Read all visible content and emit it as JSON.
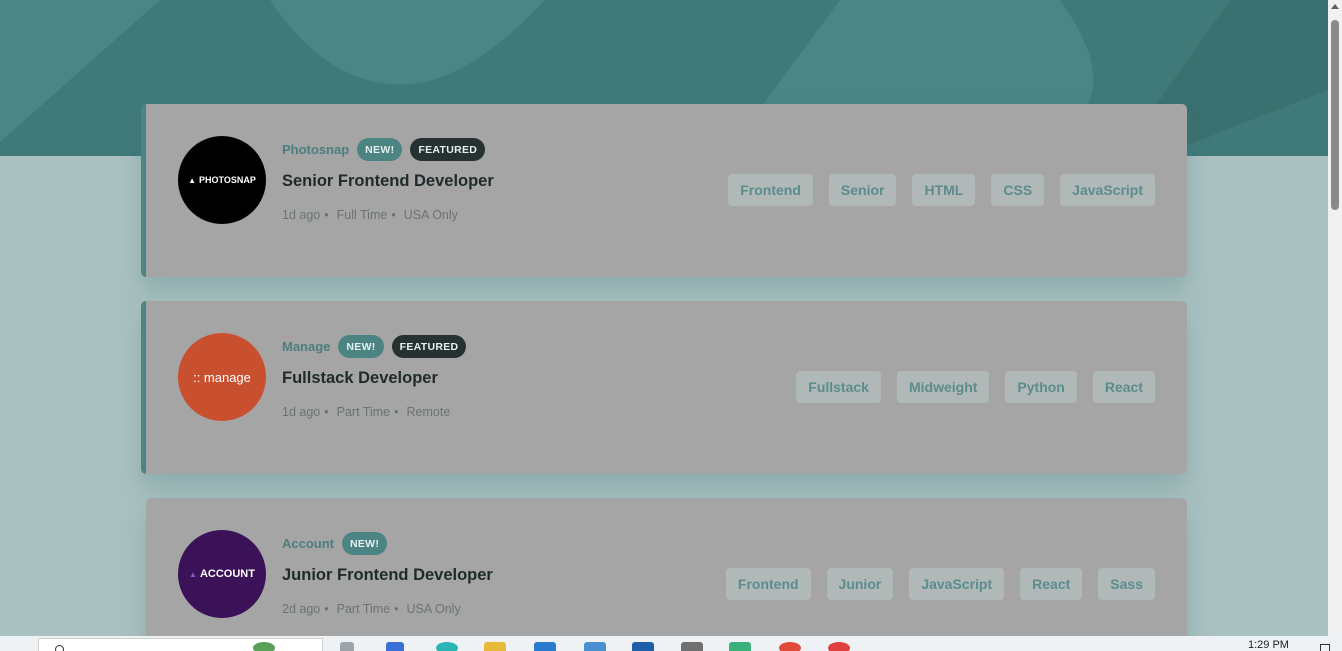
{
  "jobs": [
    {
      "company": "Photosnap",
      "logo_text": "PHOTOSNAP",
      "logo_color": "#000000",
      "new_label": "NEW!",
      "featured_label": "FEATURED",
      "position": "Senior Frontend Developer",
      "posted": "1d ago",
      "contract": "Full Time",
      "location": "USA Only",
      "tags": [
        "Frontend",
        "Senior",
        "HTML",
        "CSS",
        "JavaScript"
      ]
    },
    {
      "company": "Manage",
      "logo_text": ":: manage",
      "logo_color": "#c9502f",
      "new_label": "NEW!",
      "featured_label": "FEATURED",
      "position": "Fullstack Developer",
      "posted": "1d ago",
      "contract": "Part Time",
      "location": "Remote",
      "tags": [
        "Fullstack",
        "Midweight",
        "Python",
        "React"
      ]
    },
    {
      "company": "Account",
      "logo_text": "ACCOUNT",
      "logo_color": "#3b1157",
      "new_label": "NEW!",
      "position": "Junior Frontend Developer",
      "posted": "2d ago",
      "contract": "Part Time",
      "location": "USA Only",
      "tags": [
        "Frontend",
        "Junior",
        "JavaScript",
        "React",
        "Sass"
      ]
    }
  ],
  "separator": "•",
  "taskbar": {
    "clock": "1:29 PM"
  },
  "colors": {
    "header": "#3f7a79",
    "accent": "#4c8383",
    "featured_badge": "#263131"
  }
}
